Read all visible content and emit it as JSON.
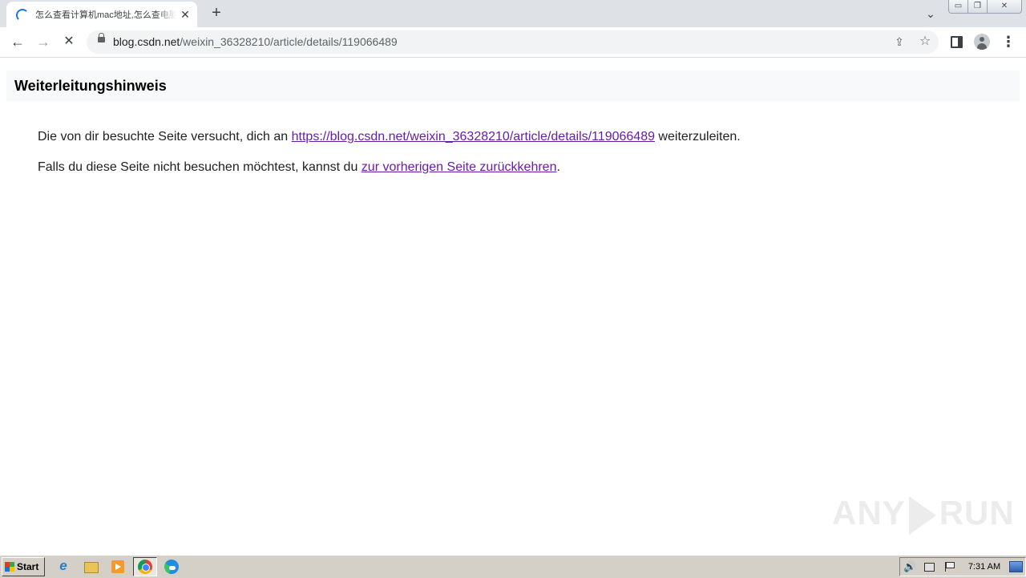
{
  "browser": {
    "tab": {
      "title": "怎么查看计算机mac地址,怎么查电脑的mac地址",
      "close_glyph": "✕"
    },
    "new_tab_glyph": "+",
    "tab_search_glyph": "⌄",
    "window_controls": {
      "minimize": "▭",
      "restore": "❐",
      "close": "✕"
    },
    "toolbar": {
      "back_glyph": "←",
      "forward_glyph": "→",
      "stop_glyph": "✕",
      "url_host": "blog.csdn.net",
      "url_path": "/weixin_36328210/article/details/119066489",
      "share_glyph": "⇪",
      "bookmark_glyph": "☆",
      "menu_glyph": "⋮"
    }
  },
  "page": {
    "heading": "Weiterleitungshinweis",
    "line1": {
      "before": "Die von dir besuchte Seite versucht, dich an ",
      "link": "https://blog.csdn.net/weixin_36328210/article/details/119066489",
      "after": " weiterzuleiten."
    },
    "line2": {
      "before": "Falls du diese Seite nicht besuchen möchtest, kannst du ",
      "link": "zur vorherigen Seite zurückkehren",
      "after": "."
    },
    "link_color": "#681da8"
  },
  "watermark": {
    "left": "ANY",
    "right": "RUN"
  },
  "taskbar": {
    "start_label": "Start",
    "clock": "7:31 AM",
    "volume_glyph": "🔊"
  },
  "icons": [
    "loading-spinner-icon",
    "back-arrow-icon",
    "forward-arrow-icon",
    "stop-icon",
    "lock-icon",
    "share-icon",
    "star-icon",
    "side-panel-icon",
    "profile-icon",
    "menu-icon",
    "ie-icon",
    "folder-icon",
    "media-player-icon",
    "chrome-icon",
    "edge-icon",
    "volume-icon",
    "network-icon",
    "flag-icon"
  ]
}
